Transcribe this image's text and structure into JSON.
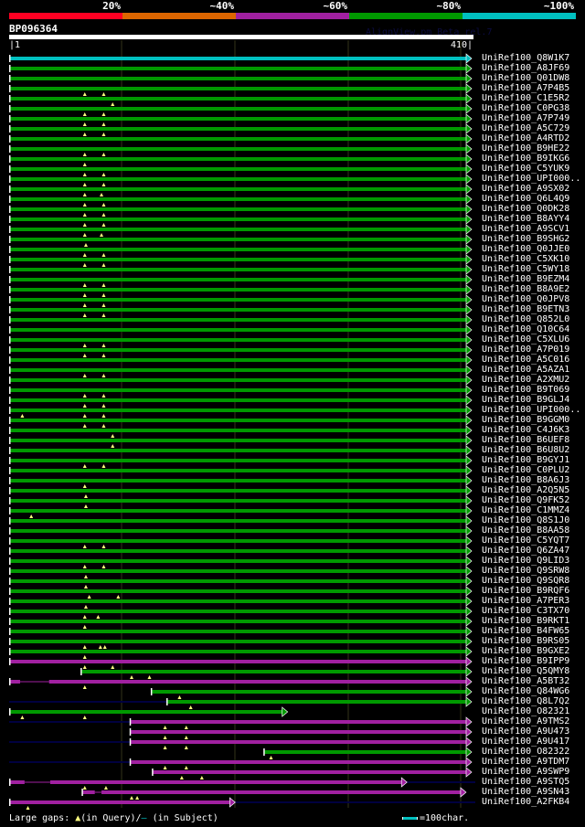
{
  "colors": {
    "green": "#009900",
    "magenta": "#a020a0",
    "cyan": "#00c0c0",
    "navy": "#000040",
    "marker": "#ffff80"
  },
  "score_legend": [
    {
      "label": "20%",
      "color": "#ff0022"
    },
    {
      "label": "~40%",
      "color": "#dd6600"
    },
    {
      "label": "~60%",
      "color": "#a020a0"
    },
    {
      "label": "~80%",
      "color": "#009900"
    },
    {
      "label": "~100%",
      "color": "#00c0c0"
    }
  ],
  "query": {
    "name": "BP096364",
    "start_label": "|1",
    "end_label": "410|",
    "length": 410
  },
  "version_text": "AlignView.pm Beta rel.7",
  "legend": {
    "prefix": "Large gaps: ",
    "query_symbol": "▲",
    "query_text": "(in Query)/",
    "subject_symbol": "–",
    "subject_text": " (in Subject)",
    "scale_text": "=100char."
  },
  "hits": [
    {
      "id": "UniRef100_Q8W1K7",
      "color": "cyan",
      "start": 1,
      "end": 410,
      "gaps": []
    },
    {
      "id": "UniRef100_A8JF69",
      "color": "green",
      "start": 1,
      "end": 410,
      "gaps": []
    },
    {
      "id": "UniRef100_Q01DW8",
      "color": "green",
      "start": 1,
      "end": 410,
      "gaps": []
    },
    {
      "id": "UniRef100_A7P4B5",
      "color": "green",
      "start": 1,
      "end": 410,
      "gaps": [
        68,
        85
      ]
    },
    {
      "id": "UniRef100_C1E5R2",
      "color": "green",
      "start": 1,
      "end": 410,
      "gaps": [
        93
      ]
    },
    {
      "id": "UniRef100_C0PG38",
      "color": "green",
      "start": 1,
      "end": 410,
      "gaps": [
        68,
        85
      ]
    },
    {
      "id": "UniRef100_A7P749",
      "color": "green",
      "start": 1,
      "end": 410,
      "gaps": [
        68,
        85
      ]
    },
    {
      "id": "UniRef100_A5C729",
      "color": "green",
      "start": 1,
      "end": 410,
      "gaps": [
        68,
        85
      ]
    },
    {
      "id": "UniRef100_A4RTD2",
      "color": "green",
      "start": 1,
      "end": 410,
      "gaps": []
    },
    {
      "id": "UniRef100_B9HE22",
      "color": "green",
      "start": 1,
      "end": 410,
      "gaps": [
        68,
        85
      ]
    },
    {
      "id": "UniRef100_B9IKG6",
      "color": "green",
      "start": 1,
      "end": 410,
      "gaps": [
        68
      ]
    },
    {
      "id": "UniRef100_C5YUK9",
      "color": "green",
      "start": 1,
      "end": 410,
      "gaps": [
        68,
        85
      ]
    },
    {
      "id": "UniRef100_UPI000..",
      "color": "green",
      "start": 1,
      "end": 410,
      "gaps": [
        68,
        85
      ]
    },
    {
      "id": "UniRef100_A9SX02",
      "color": "green",
      "start": 1,
      "end": 410,
      "gaps": [
        68,
        83
      ]
    },
    {
      "id": "UniRef100_Q6L4Q9",
      "color": "green",
      "start": 1,
      "end": 410,
      "gaps": [
        68,
        85
      ]
    },
    {
      "id": "UniRef100_Q0DK28",
      "color": "green",
      "start": 1,
      "end": 410,
      "gaps": [
        68,
        85
      ]
    },
    {
      "id": "UniRef100_B8AYY4",
      "color": "green",
      "start": 1,
      "end": 410,
      "gaps": [
        68,
        85
      ]
    },
    {
      "id": "UniRef100_A9SCV1",
      "color": "green",
      "start": 1,
      "end": 410,
      "gaps": [
        68,
        83
      ]
    },
    {
      "id": "UniRef100_B9SHG2",
      "color": "green",
      "start": 1,
      "end": 410,
      "gaps": [
        69
      ]
    },
    {
      "id": "UniRef100_Q0JJE0",
      "color": "green",
      "start": 1,
      "end": 410,
      "gaps": [
        68,
        85
      ]
    },
    {
      "id": "UniRef100_C5XK10",
      "color": "green",
      "start": 1,
      "end": 410,
      "gaps": [
        68,
        85
      ]
    },
    {
      "id": "UniRef100_C5WY18",
      "color": "green",
      "start": 1,
      "end": 410,
      "gaps": []
    },
    {
      "id": "UniRef100_B9EZM4",
      "color": "green",
      "start": 1,
      "end": 410,
      "gaps": [
        68,
        85
      ]
    },
    {
      "id": "UniRef100_B8A9E2",
      "color": "green",
      "start": 1,
      "end": 410,
      "gaps": [
        68,
        85
      ]
    },
    {
      "id": "UniRef100_Q0JPV8",
      "color": "green",
      "start": 1,
      "end": 410,
      "gaps": [
        68,
        85
      ]
    },
    {
      "id": "UniRef100_B9ETN3",
      "color": "green",
      "start": 1,
      "end": 410,
      "gaps": [
        68,
        85
      ]
    },
    {
      "id": "UniRef100_Q852L0",
      "color": "green",
      "start": 1,
      "end": 410,
      "gaps": []
    },
    {
      "id": "UniRef100_Q10C64",
      "color": "green",
      "start": 1,
      "end": 410,
      "gaps": []
    },
    {
      "id": "UniRef100_C5XLU6",
      "color": "green",
      "start": 1,
      "end": 410,
      "gaps": [
        68,
        85
      ]
    },
    {
      "id": "UniRef100_A7P019",
      "color": "green",
      "start": 1,
      "end": 410,
      "gaps": [
        68,
        85
      ]
    },
    {
      "id": "UniRef100_A5C016",
      "color": "green",
      "start": 1,
      "end": 410,
      "gaps": []
    },
    {
      "id": "UniRef100_A5AZA1",
      "color": "green",
      "start": 1,
      "end": 410,
      "gaps": [
        68,
        85
      ]
    },
    {
      "id": "UniRef100_A2XMU2",
      "color": "green",
      "start": 1,
      "end": 410,
      "gaps": []
    },
    {
      "id": "UniRef100_B9T069",
      "color": "green",
      "start": 1,
      "end": 410,
      "gaps": [
        68,
        85
      ]
    },
    {
      "id": "UniRef100_B9GLJ4",
      "color": "green",
      "start": 1,
      "end": 410,
      "gaps": [
        68,
        85
      ]
    },
    {
      "id": "UniRef100_UPI000..",
      "color": "green",
      "start": 1,
      "end": 410,
      "gaps": [
        12,
        68,
        85
      ]
    },
    {
      "id": "UniRef100_B9GGM0",
      "color": "green",
      "start": 1,
      "end": 410,
      "gaps": [
        68,
        85
      ]
    },
    {
      "id": "UniRef100_C4J6K3",
      "color": "green",
      "start": 1,
      "end": 410,
      "gaps": [
        93
      ]
    },
    {
      "id": "UniRef100_B6UEF8",
      "color": "green",
      "start": 1,
      "end": 410,
      "gaps": [
        93
      ]
    },
    {
      "id": "UniRef100_B6U8U2",
      "color": "green",
      "start": 1,
      "end": 410,
      "gaps": []
    },
    {
      "id": "UniRef100_B9GYJ1",
      "color": "green",
      "start": 1,
      "end": 410,
      "gaps": [
        68,
        85
      ]
    },
    {
      "id": "UniRef100_C0PLU2",
      "color": "green",
      "start": 1,
      "end": 410,
      "gaps": []
    },
    {
      "id": "UniRef100_B8A6J3",
      "color": "green",
      "start": 1,
      "end": 410,
      "gaps": [
        68
      ]
    },
    {
      "id": "UniRef100_A2Q5N5",
      "color": "green",
      "start": 1,
      "end": 410,
      "gaps": [
        69
      ]
    },
    {
      "id": "UniRef100_Q9FK52",
      "color": "green",
      "start": 1,
      "end": 410,
      "gaps": [
        69
      ]
    },
    {
      "id": "UniRef100_C1MMZ4",
      "color": "green",
      "start": 1,
      "end": 410,
      "gaps": [
        20
      ]
    },
    {
      "id": "UniRef100_Q8S1J0",
      "color": "green",
      "start": 1,
      "end": 410,
      "gaps": []
    },
    {
      "id": "UniRef100_B8AA58",
      "color": "green",
      "start": 1,
      "end": 410,
      "gaps": []
    },
    {
      "id": "UniRef100_C5YQT7",
      "color": "green",
      "start": 1,
      "end": 410,
      "gaps": [
        68,
        85
      ]
    },
    {
      "id": "UniRef100_Q6ZA47",
      "color": "green",
      "start": 1,
      "end": 410,
      "gaps": []
    },
    {
      "id": "UniRef100_Q9LID3",
      "color": "green",
      "start": 1,
      "end": 410,
      "gaps": [
        68,
        85
      ]
    },
    {
      "id": "UniRef100_Q9SRW8",
      "color": "green",
      "start": 1,
      "end": 410,
      "gaps": [
        69
      ]
    },
    {
      "id": "UniRef100_Q9SQR8",
      "color": "green",
      "start": 1,
      "end": 410,
      "gaps": [
        69
      ]
    },
    {
      "id": "UniRef100_B9RQF6",
      "color": "green",
      "start": 1,
      "end": 410,
      "gaps": [
        72,
        98
      ]
    },
    {
      "id": "UniRef100_A7PER3",
      "color": "green",
      "start": 1,
      "end": 410,
      "gaps": [
        69
      ]
    },
    {
      "id": "UniRef100_C3TX70",
      "color": "green",
      "start": 1,
      "end": 410,
      "gaps": [
        68,
        80
      ]
    },
    {
      "id": "UniRef100_B9RKT1",
      "color": "green",
      "start": 1,
      "end": 410,
      "gaps": [
        68
      ]
    },
    {
      "id": "UniRef100_B4FW65",
      "color": "green",
      "start": 1,
      "end": 410,
      "gaps": []
    },
    {
      "id": "UniRef100_B9RS05",
      "color": "green",
      "start": 1,
      "end": 410,
      "gaps": [
        68,
        82,
        86
      ]
    },
    {
      "id": "UniRef100_B9GXE2",
      "color": "green",
      "start": 1,
      "end": 410,
      "gaps": [
        68
      ]
    },
    {
      "id": "UniRef100_B9IPP9",
      "color": "magenta",
      "start": 1,
      "end": 410,
      "gaps": [
        68,
        93
      ]
    },
    {
      "id": "UniRef100_Q5QMY8",
      "color": "green",
      "start": 65,
      "end": 410,
      "gaps": [
        110,
        126
      ]
    },
    {
      "id": "UniRef100_A5BT32",
      "color": "magenta",
      "start": 1,
      "end": 410,
      "gaps": [
        68
      ],
      "thin": [
        10,
        36
      ]
    },
    {
      "id": "UniRef100_Q84WG6",
      "color": "green",
      "start": 128,
      "end": 410,
      "gaps": [
        153
      ]
    },
    {
      "id": "UniRef100_Q8L7Q2",
      "color": "green",
      "start": 142,
      "end": 410,
      "gaps": [
        163
      ],
      "navy_before": true
    },
    {
      "id": "UniRef100_O82321",
      "color": "green",
      "start": 1,
      "end": 245,
      "gaps": [
        12,
        68
      ]
    },
    {
      "id": "UniRef100_A9TMS2",
      "color": "magenta",
      "start": 109,
      "end": 410,
      "gaps": [
        140,
        159
      ],
      "navy_before": true
    },
    {
      "id": "UniRef100_A9U473",
      "color": "magenta",
      "start": 109,
      "end": 410,
      "gaps": [
        140,
        159
      ]
    },
    {
      "id": "UniRef100_A9U417",
      "color": "magenta",
      "start": 109,
      "end": 410,
      "gaps": [
        140,
        159
      ],
      "navy_before": true
    },
    {
      "id": "UniRef100_O82322",
      "color": "green",
      "start": 229,
      "end": 410,
      "gaps": [
        235
      ]
    },
    {
      "id": "UniRef100_A9TDM7",
      "color": "magenta",
      "start": 109,
      "end": 410,
      "gaps": [
        140,
        159
      ],
      "navy_before": true
    },
    {
      "id": "UniRef100_A9SWP9",
      "color": "magenta",
      "start": 129,
      "end": 410,
      "gaps": [
        155,
        173
      ]
    },
    {
      "id": "UniRef100_A9STQ5",
      "color": "magenta",
      "start": 1,
      "end": 352,
      "gaps": [
        68,
        87
      ],
      "thin": [
        14,
        37
      ],
      "navy_after": true
    },
    {
      "id": "UniRef100_A9SN43",
      "color": "magenta",
      "start": 66,
      "end": 405,
      "gaps": [
        110,
        115
      ],
      "thin": [
        77,
        83
      ]
    },
    {
      "id": "UniRef100_A2FKB4",
      "color": "magenta",
      "start": 1,
      "end": 198,
      "gaps": [
        17
      ],
      "navy_after": true
    }
  ]
}
